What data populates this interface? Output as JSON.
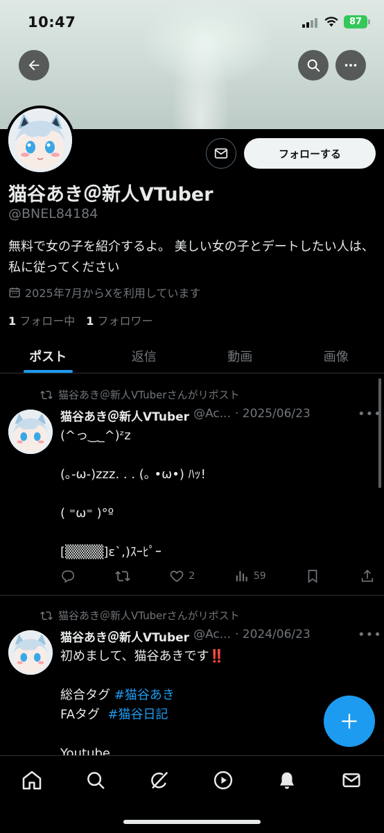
{
  "status_bar": {
    "time": "10:47",
    "battery": "87"
  },
  "profile": {
    "display_name": "猫谷あき＠新人VTuber",
    "handle": "@BNEL84184",
    "bio": "無料で女の子を紹介するよ。 美しい女の子とデートしたい人は、私に従ってください",
    "joined": "2025年7月からXを利用しています",
    "following_count": "1",
    "following_label": "フォロー中",
    "followers_count": "1",
    "followers_label": "フォロワー",
    "follow_button": "フォローする"
  },
  "tabs": [
    {
      "label": "ポスト",
      "active": true
    },
    {
      "label": "返信",
      "active": false
    },
    {
      "label": "動画",
      "active": false
    },
    {
      "label": "画像",
      "active": false
    }
  ],
  "posts": [
    {
      "repost_label": "猫谷あき＠新人VTuberさんがリポスト",
      "author": "猫谷あき＠新人VTuber",
      "handle": "@Ac...",
      "date": "· 2025/06/23",
      "text": "(^っ‿_^)ᶻz\n\n(｡-ω-)zzz. . . (｡ •ω•) ﾊｯ!\n\n( ⁼ω⁼ )°º\n\n[▒▒▒▒]ε`,)ｽｰﾋﾟｰ",
      "likes": "2",
      "views": "59"
    },
    {
      "repost_label": "猫谷あき＠新人VTuberさんがリポスト",
      "author": "猫谷あき＠新人VTuber",
      "handle": "@Ac...",
      "date": "· 2024/06/23",
      "line1": "初めまして、猫谷あきです",
      "emoji": "‼️",
      "tag1_label": "総合タグ ",
      "tag1": "#猫谷あき",
      "tag2_label": "FAタグ  ",
      "tag2": "#猫谷日記",
      "line4": "Youtube"
    }
  ],
  "icons": {
    "back": "back-arrow-icon",
    "search": "search-icon",
    "more": "more-icon",
    "mail": "mail-icon",
    "calendar": "calendar-icon",
    "repost": "repost-icon",
    "reply": "reply-icon",
    "like": "heart-icon",
    "views": "views-icon",
    "bookmark": "bookmark-icon",
    "share": "share-icon",
    "compose": "plus-icon",
    "nav": [
      "home-icon",
      "search-icon",
      "grok-icon",
      "play-icon",
      "bell-icon",
      "mail-icon"
    ]
  },
  "colors": {
    "accent": "#1d9bf0",
    "background": "#000000",
    "battery": "#34c759"
  }
}
